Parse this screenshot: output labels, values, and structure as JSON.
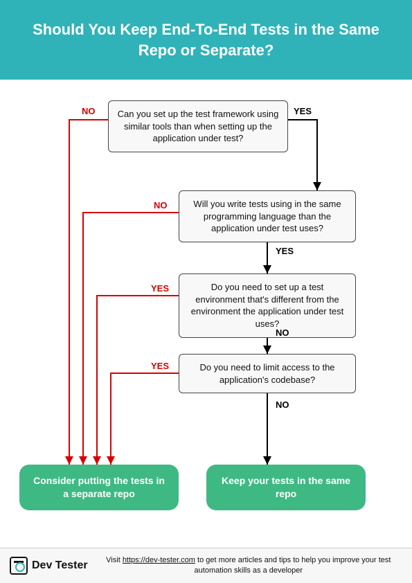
{
  "header": {
    "title": "Should You Keep End-To-End Tests in the Same Repo or Separate?"
  },
  "questions": {
    "q1": "Can you set up the test framework using similar tools than when setting up the application under test?",
    "q2": "Will you write tests using in the same programming language than the application under test uses?",
    "q3": "Do you need to set up a test environment that's different from the environment the application under test uses?",
    "q4": "Do you need to limit access to the application's codebase?"
  },
  "labels": {
    "yes": "YES",
    "no": "NO",
    "q1_left": "NO",
    "q1_right": "YES",
    "q2_left": "NO",
    "q2_down": "YES",
    "q3_left": "YES",
    "q3_down": "NO",
    "q4_left": "YES",
    "q4_down": "NO"
  },
  "outcomes": {
    "separate": "Consider putting the tests in a separate repo",
    "same": "Keep your tests in the same repo"
  },
  "footer": {
    "brand": "Dev Tester",
    "text_prefix": "Visit ",
    "url": "https://dev-tester.com",
    "text_suffix": " to get more articles and tips to help you improve your test automation skills as a developer"
  }
}
